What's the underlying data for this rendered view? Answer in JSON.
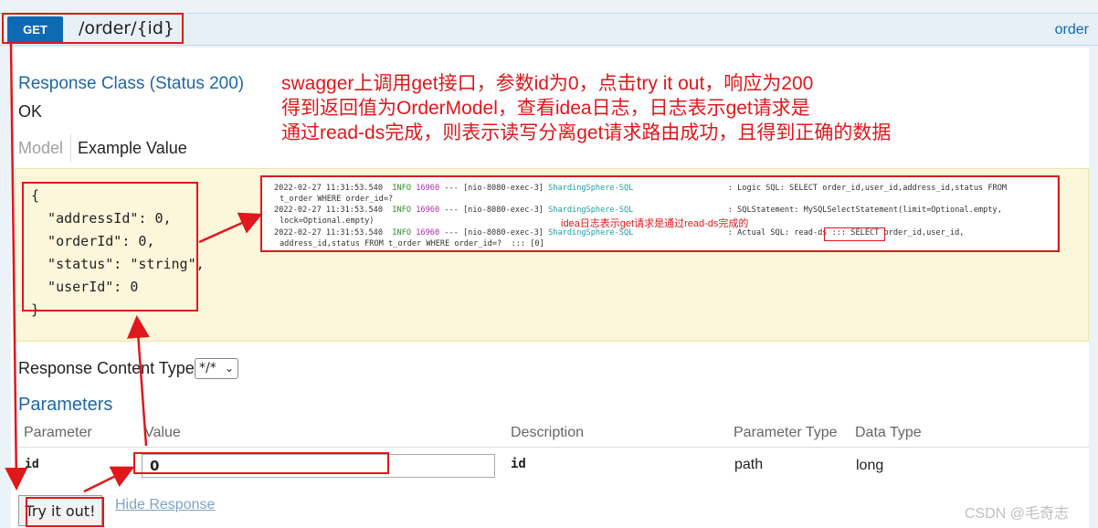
{
  "operation": {
    "method": "GET",
    "path": "/order/{id}",
    "tag": "order"
  },
  "response": {
    "class_title": "Response Class (Status 200)",
    "status_text": "OK",
    "tab_model": "Model",
    "tab_example": "Example Value",
    "example_json_lines": [
      "{",
      "  \"addressId\": 0,",
      "  \"orderId\": 0,",
      "  \"status\": \"string\",",
      "  \"userId\": 0",
      "}"
    ]
  },
  "annotation": {
    "lines": [
      "swagger上调用get接口，参数id为0，点击try it out，响应为200",
      "得到返回值为OrderModel，查看idea日志，日志表示get请求是",
      "通过read-ds完成，则表示读写分离get请求路由成功，且得到正确的数据"
    ],
    "color": "#e0171b"
  },
  "log": {
    "lines": [
      {
        "time": "2022-02-27 11:31:53.540",
        "level": "INFO",
        "pid": "16960",
        "thread": "--- [nio-8080-exec-3]",
        "logger": "ShardingSphere-SQL",
        "message": ": Logic SQL: SELECT order_id,user_id,address_id,status FROM"
      },
      {
        "cont": "t_order WHERE order_id=?"
      },
      {
        "time": "2022-02-27 11:31:53.540",
        "level": "INFO",
        "pid": "16960",
        "thread": "--- [nio-8080-exec-3]",
        "logger": "ShardingSphere-SQL",
        "message": ": SQLStatement: MySQLSelectStatement(limit=Optional.empty,"
      },
      {
        "cont": "lock=Optional.empty)"
      },
      {
        "time": "2022-02-27 11:31:53.540",
        "level": "INFO",
        "pid": "16960",
        "thread": "--- [nio-8080-exec-3]",
        "logger": "ShardingSphere-SQL",
        "message": ": Actual SQL: read-ds ::: SELECT order_id,user_id,"
      },
      {
        "cont": "address_id,status FROM t_order WHERE order_id=?  ::: [0]"
      }
    ],
    "annotation": "idea日志表示get请求是通过read-ds完成的"
  },
  "content_type": {
    "label": "Response Content Type",
    "selected": "*/*"
  },
  "parameters": {
    "title": "Parameters",
    "headers": [
      "Parameter",
      "Value",
      "Description",
      "Parameter Type",
      "Data Type"
    ],
    "rows": [
      {
        "name": "id",
        "value": "0",
        "description": "id",
        "param_type": "path",
        "data_type": "long"
      }
    ]
  },
  "actions": {
    "try_label": "Try it out!",
    "hide_label": "Hide Response"
  },
  "watermark": "CSDN @毛奇志",
  "colors": {
    "method_badge": "#0f6ab4",
    "header_bg": "#e7f0f7",
    "example_bg": "#fcf6db",
    "annotation_red": "#e0171b",
    "link_blue": "#1f66a6"
  }
}
